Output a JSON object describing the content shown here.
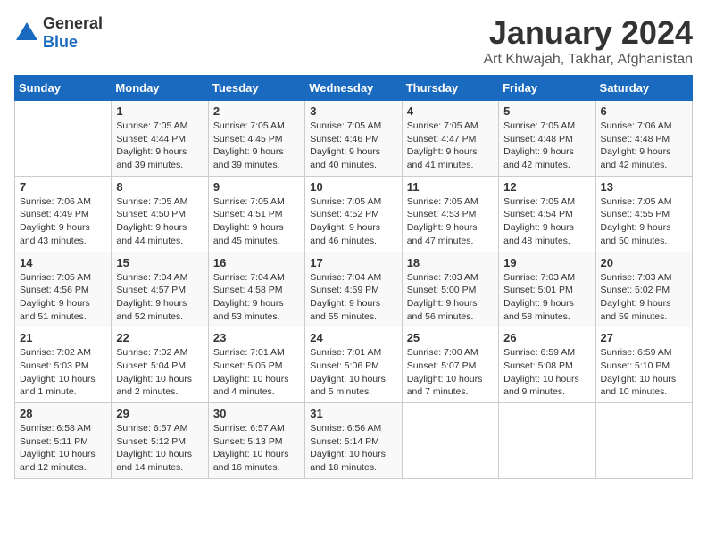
{
  "logo": {
    "general": "General",
    "blue": "Blue"
  },
  "title": "January 2024",
  "subtitle": "Art Khwajah, Takhar, Afghanistan",
  "days_of_week": [
    "Sunday",
    "Monday",
    "Tuesday",
    "Wednesday",
    "Thursday",
    "Friday",
    "Saturday"
  ],
  "weeks": [
    [
      {
        "day": "",
        "info": ""
      },
      {
        "day": "1",
        "info": "Sunrise: 7:05 AM\nSunset: 4:44 PM\nDaylight: 9 hours\nand 39 minutes."
      },
      {
        "day": "2",
        "info": "Sunrise: 7:05 AM\nSunset: 4:45 PM\nDaylight: 9 hours\nand 39 minutes."
      },
      {
        "day": "3",
        "info": "Sunrise: 7:05 AM\nSunset: 4:46 PM\nDaylight: 9 hours\nand 40 minutes."
      },
      {
        "day": "4",
        "info": "Sunrise: 7:05 AM\nSunset: 4:47 PM\nDaylight: 9 hours\nand 41 minutes."
      },
      {
        "day": "5",
        "info": "Sunrise: 7:05 AM\nSunset: 4:48 PM\nDaylight: 9 hours\nand 42 minutes."
      },
      {
        "day": "6",
        "info": "Sunrise: 7:06 AM\nSunset: 4:48 PM\nDaylight: 9 hours\nand 42 minutes."
      }
    ],
    [
      {
        "day": "7",
        "info": "Sunrise: 7:06 AM\nSunset: 4:49 PM\nDaylight: 9 hours\nand 43 minutes."
      },
      {
        "day": "8",
        "info": "Sunrise: 7:05 AM\nSunset: 4:50 PM\nDaylight: 9 hours\nand 44 minutes."
      },
      {
        "day": "9",
        "info": "Sunrise: 7:05 AM\nSunset: 4:51 PM\nDaylight: 9 hours\nand 45 minutes."
      },
      {
        "day": "10",
        "info": "Sunrise: 7:05 AM\nSunset: 4:52 PM\nDaylight: 9 hours\nand 46 minutes."
      },
      {
        "day": "11",
        "info": "Sunrise: 7:05 AM\nSunset: 4:53 PM\nDaylight: 9 hours\nand 47 minutes."
      },
      {
        "day": "12",
        "info": "Sunrise: 7:05 AM\nSunset: 4:54 PM\nDaylight: 9 hours\nand 48 minutes."
      },
      {
        "day": "13",
        "info": "Sunrise: 7:05 AM\nSunset: 4:55 PM\nDaylight: 9 hours\nand 50 minutes."
      }
    ],
    [
      {
        "day": "14",
        "info": "Sunrise: 7:05 AM\nSunset: 4:56 PM\nDaylight: 9 hours\nand 51 minutes."
      },
      {
        "day": "15",
        "info": "Sunrise: 7:04 AM\nSunset: 4:57 PM\nDaylight: 9 hours\nand 52 minutes."
      },
      {
        "day": "16",
        "info": "Sunrise: 7:04 AM\nSunset: 4:58 PM\nDaylight: 9 hours\nand 53 minutes."
      },
      {
        "day": "17",
        "info": "Sunrise: 7:04 AM\nSunset: 4:59 PM\nDaylight: 9 hours\nand 55 minutes."
      },
      {
        "day": "18",
        "info": "Sunrise: 7:03 AM\nSunset: 5:00 PM\nDaylight: 9 hours\nand 56 minutes."
      },
      {
        "day": "19",
        "info": "Sunrise: 7:03 AM\nSunset: 5:01 PM\nDaylight: 9 hours\nand 58 minutes."
      },
      {
        "day": "20",
        "info": "Sunrise: 7:03 AM\nSunset: 5:02 PM\nDaylight: 9 hours\nand 59 minutes."
      }
    ],
    [
      {
        "day": "21",
        "info": "Sunrise: 7:02 AM\nSunset: 5:03 PM\nDaylight: 10 hours\nand 1 minute."
      },
      {
        "day": "22",
        "info": "Sunrise: 7:02 AM\nSunset: 5:04 PM\nDaylight: 10 hours\nand 2 minutes."
      },
      {
        "day": "23",
        "info": "Sunrise: 7:01 AM\nSunset: 5:05 PM\nDaylight: 10 hours\nand 4 minutes."
      },
      {
        "day": "24",
        "info": "Sunrise: 7:01 AM\nSunset: 5:06 PM\nDaylight: 10 hours\nand 5 minutes."
      },
      {
        "day": "25",
        "info": "Sunrise: 7:00 AM\nSunset: 5:07 PM\nDaylight: 10 hours\nand 7 minutes."
      },
      {
        "day": "26",
        "info": "Sunrise: 6:59 AM\nSunset: 5:08 PM\nDaylight: 10 hours\nand 9 minutes."
      },
      {
        "day": "27",
        "info": "Sunrise: 6:59 AM\nSunset: 5:10 PM\nDaylight: 10 hours\nand 10 minutes."
      }
    ],
    [
      {
        "day": "28",
        "info": "Sunrise: 6:58 AM\nSunset: 5:11 PM\nDaylight: 10 hours\nand 12 minutes."
      },
      {
        "day": "29",
        "info": "Sunrise: 6:57 AM\nSunset: 5:12 PM\nDaylight: 10 hours\nand 14 minutes."
      },
      {
        "day": "30",
        "info": "Sunrise: 6:57 AM\nSunset: 5:13 PM\nDaylight: 10 hours\nand 16 minutes."
      },
      {
        "day": "31",
        "info": "Sunrise: 6:56 AM\nSunset: 5:14 PM\nDaylight: 10 hours\nand 18 minutes."
      },
      {
        "day": "",
        "info": ""
      },
      {
        "day": "",
        "info": ""
      },
      {
        "day": "",
        "info": ""
      }
    ]
  ]
}
